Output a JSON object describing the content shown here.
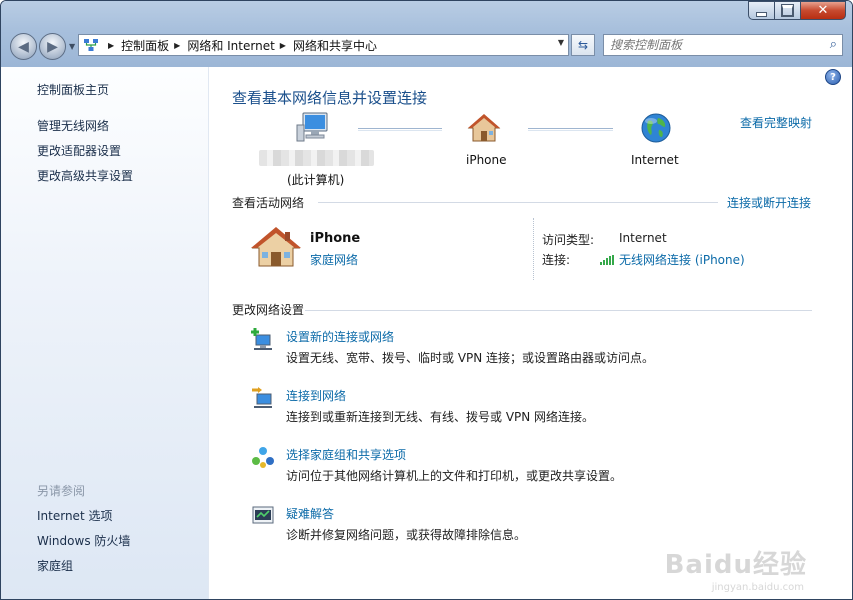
{
  "window": {
    "caption_buttons": {
      "minimize_icon": "minimize-icon",
      "maximize_icon": "maximize-icon",
      "close_icon": "close-icon"
    }
  },
  "nav": {
    "back_icon": "back-arrow-icon",
    "forward_icon": "forward-arrow-icon"
  },
  "address": {
    "crumbs": [
      "控制面板",
      "网络和 Internet",
      "网络和共享中心"
    ]
  },
  "search": {
    "placeholder": "搜索控制面板"
  },
  "sidebar": {
    "links": [
      "控制面板主页",
      "管理无线网络",
      "更改适配器设置",
      "更改高级共享设置"
    ],
    "see_also_heading": "另请参阅",
    "see_also": [
      "Internet 选项",
      "Windows 防火墙",
      "家庭组"
    ]
  },
  "main": {
    "title": "查看基本网络信息并设置连接",
    "view_full_map": "查看完整映射",
    "network_map": {
      "computer_label": "(此计算机)",
      "middle_label": "iPhone",
      "right_label": "Internet"
    },
    "active_section": {
      "heading": "查看活动网络",
      "connect_disconnect": "连接或断开连接",
      "network_name": "iPhone",
      "network_type": "家庭网络",
      "access_type_label": "访问类型:",
      "access_type_value": "Internet",
      "connections_label": "连接:",
      "connections_value": "无线网络连接 (iPhone)"
    },
    "change_section": {
      "heading": "更改网络设置",
      "items": [
        {
          "title": "设置新的连接或网络",
          "desc": "设置无线、宽带、拨号、临时或 VPN 连接；或设置路由器或访问点。"
        },
        {
          "title": "连接到网络",
          "desc": "连接到或重新连接到无线、有线、拨号或 VPN 网络连接。"
        },
        {
          "title": "选择家庭组和共享选项",
          "desc": "访问位于其他网络计算机上的文件和打印机，或更改共享设置。"
        },
        {
          "title": "疑难解答",
          "desc": "诊断并修复网络问题，或获得故障排除信息。"
        }
      ]
    }
  },
  "watermark": {
    "brand": "Baidu经验",
    "url": "jingyan.baidu.com"
  },
  "colors": {
    "link": "#0b6aa8",
    "title": "#1a4f8b",
    "chrome": "#a7bfdc",
    "signal": "#35a84a"
  }
}
